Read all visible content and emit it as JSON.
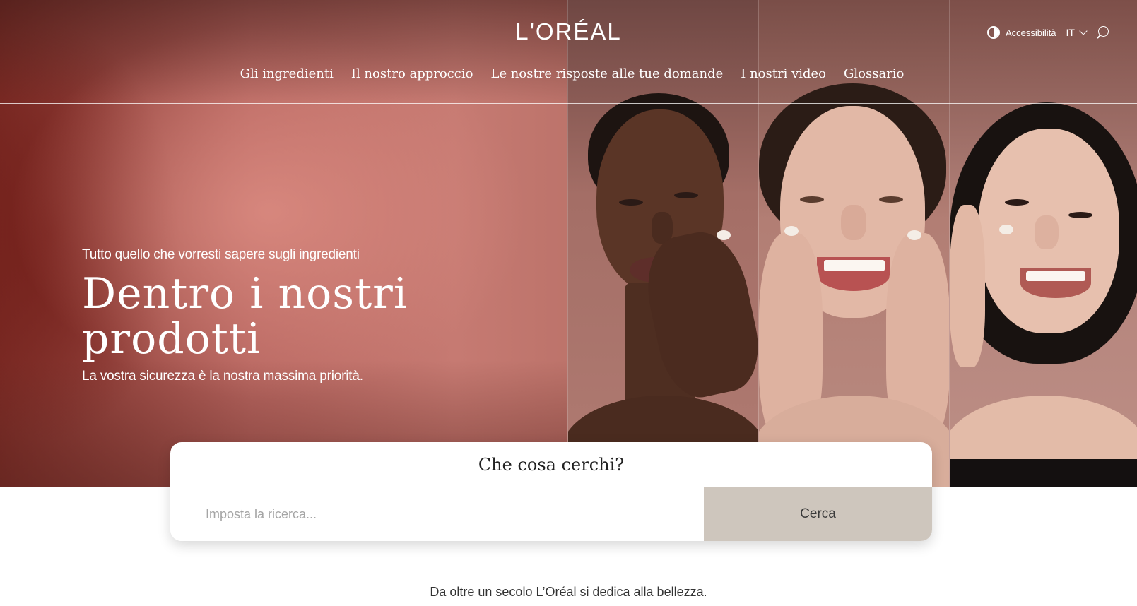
{
  "header": {
    "logo": "L'ORÉAL",
    "accessibility_label": "Accessibilità",
    "language": "IT",
    "nav": [
      {
        "label": "Gli ingredienti"
      },
      {
        "label": "Il nostro approccio"
      },
      {
        "label": "Le nostre risposte alle tue domande"
      },
      {
        "label": "I nostri video"
      },
      {
        "label": "Glossario"
      }
    ]
  },
  "hero": {
    "eyebrow": "Tutto quello che vorresti sapere sugli ingredienti",
    "headline_line1": "Dentro i nostri",
    "headline_line2": "prodotti",
    "subhead": "La vostra sicurezza è la nostra massima priorità."
  },
  "search": {
    "title": "Che cosa cerchi?",
    "placeholder": "Imposta la ricerca...",
    "button_label": "Cerca"
  },
  "intro": {
    "text": "Da oltre un secolo L’Oréal si dedica alla bellezza."
  }
}
